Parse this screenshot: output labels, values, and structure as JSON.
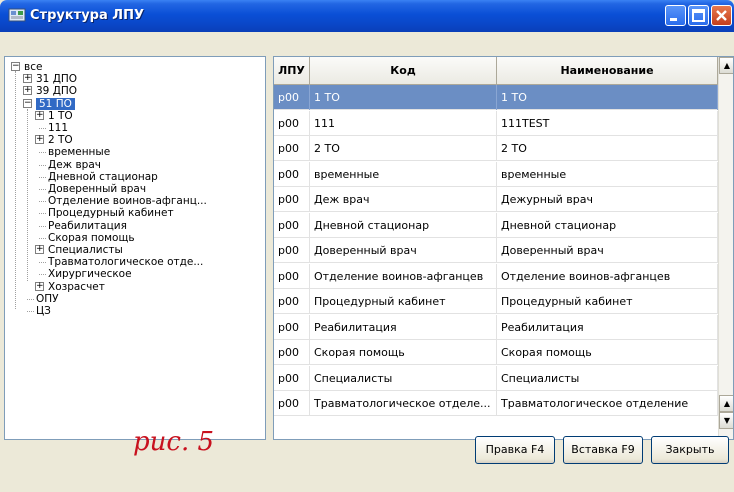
{
  "window": {
    "title": "Структура ЛПУ",
    "accent_color": "#0a4fd6"
  },
  "tree": {
    "items": [
      {
        "label": "все",
        "expander": "⊟"
      },
      {
        "label": "31 ДПО",
        "expander": "⊞"
      },
      {
        "label": "39 ДПО",
        "expander": "⊞"
      },
      {
        "label": "51 ПО",
        "expander": "⊟",
        "selected": true
      },
      {
        "label": "1 ТО",
        "expander": "⊞"
      },
      {
        "label": "111"
      },
      {
        "label": "2 ТО",
        "expander": "⊞"
      },
      {
        "label": "временные"
      },
      {
        "label": "Деж врач"
      },
      {
        "label": "Дневной стационар"
      },
      {
        "label": "Доверенный врач"
      },
      {
        "label": "Отделение воинов-афганц..."
      },
      {
        "label": "Процедурный кабинет"
      },
      {
        "label": "Реабилитация"
      },
      {
        "label": "Скорая помощь"
      },
      {
        "label": "Специалисты",
        "expander": "⊞"
      },
      {
        "label": "Травматологическое отде..."
      },
      {
        "label": "Хирургическое"
      },
      {
        "label": "Хозрасчет",
        "expander": "⊞"
      },
      {
        "label": "ОПУ"
      },
      {
        "label": "ЦЗ"
      }
    ]
  },
  "grid": {
    "columns": [
      "ЛПУ",
      "Код",
      "Наименование"
    ],
    "rows": [
      [
        "p00",
        "1 ТО",
        "1 ТО"
      ],
      [
        "p00",
        "111",
        "111TEST"
      ],
      [
        "p00",
        "2 ТО",
        "2 ТО"
      ],
      [
        "p00",
        "временные",
        "временные"
      ],
      [
        "p00",
        "Деж врач",
        "Дежурный врач"
      ],
      [
        "p00",
        "Дневной стационар",
        "Дневной стационар"
      ],
      [
        "p00",
        "Доверенный врач",
        "Доверенный врач"
      ],
      [
        "p00",
        "Отделение воинов-афганцев",
        "Отделение воинов-афганцев"
      ],
      [
        "p00",
        "Процедурный кабинет",
        "Процедурный кабинет"
      ],
      [
        "p00",
        "Реабилитация",
        "Реабилитация"
      ],
      [
        "p00",
        "Скорая помощь",
        "Скорая помощь"
      ],
      [
        "p00",
        "Специалисты",
        "Специалисты"
      ],
      [
        "p00",
        "Травматологическое отделе...",
        "Травматологическое отделение"
      ]
    ],
    "selected_row_color": "#6b8ec4"
  },
  "caption": "рис. 5",
  "buttons": {
    "edit": "Правка F4",
    "insert": "Вставка F9",
    "close": "Закрыть"
  }
}
